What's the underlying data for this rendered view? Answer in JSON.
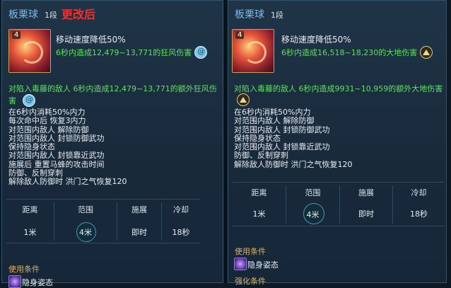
{
  "left": {
    "title": "板栗球",
    "level": "1段",
    "changed_tag": "更改后",
    "rank": "4",
    "effect": "移动速度降低50%",
    "damage": "6秒内造成12,479~13,771的狂风伤害",
    "extra_line1": "对陷入毒藤的敌人 6秒内造成12,479~13,771的额外狂风伤",
    "extra_line2": "害",
    "lines": [
      "在6秒内消耗50%内力",
      "每次命中后 恢复3内力",
      "对范围内敌人 解除防御",
      "对范围内敌人 封锁防御武功",
      "保持隐身状态",
      "对范围内敌人 封锁靠近武功",
      "施展后 重置马蜂的攻击时间",
      "防御、反制穿刺",
      "解除敌人防御时 洪门之气恢复120"
    ],
    "stats": {
      "headers": [
        "距离",
        "范围",
        "施展",
        "冷却"
      ],
      "values": [
        "1米",
        "4米",
        "即时",
        "18秒"
      ]
    },
    "condition_label": "使用条件",
    "stealth_label": "隐身姿态"
  },
  "right": {
    "title": "板栗球",
    "level": "1段",
    "rank": "4",
    "effect": "移动速度降低50%",
    "damage": "6秒内造成16,518~18,230的大地伤害",
    "extra_line1": "对陷入毒藤的敌人 6秒内造成9931~10,959的额外大地伤害",
    "lines": [
      "在6秒内消耗50%内力",
      "对范围内敌人 解除防御",
      "对范围内敌人 封锁防御武功",
      "保持隐身状态",
      "对范围内敌人 封锁靠近武功",
      "防御、反制穿刺",
      "解除敌人防御时 洪门之气恢复120"
    ],
    "stats": {
      "headers": [
        "距离",
        "范围",
        "施展",
        "冷却"
      ],
      "values": [
        "1米",
        "4米",
        "即时",
        "18秒"
      ]
    },
    "condition_label": "使用条件",
    "stealth_label": "隐身姿态",
    "enhance_label": "强化条件"
  },
  "icons": {
    "wind_badge": "wind-element-icon",
    "earth_badge": "earth-element-icon",
    "skill": "chestnut-ball-skill-icon",
    "stealth": "stealth-stance-icon"
  },
  "colors": {
    "title": "#7fb9e6",
    "changed": "#ff2a2a",
    "damage": "#5ee05e",
    "condition": "#d9b16a"
  }
}
